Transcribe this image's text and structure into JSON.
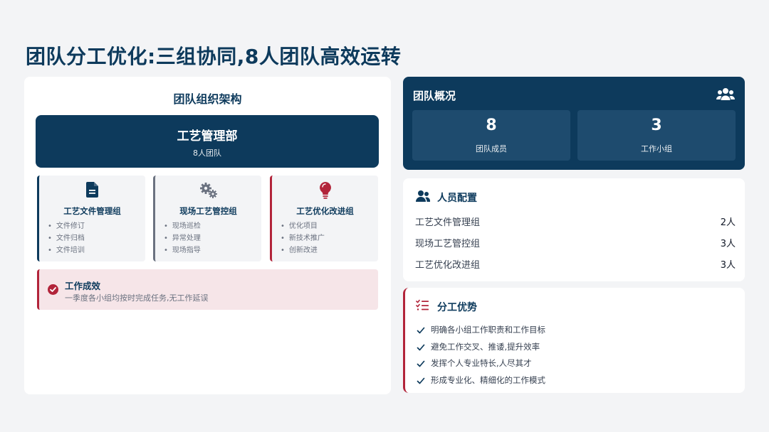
{
  "page": {
    "title": "团队分工优化:三组协同,8人团队高效运转"
  },
  "org": {
    "title": "团队组织架构",
    "department": {
      "name": "工艺管理部",
      "sub": "8人团队"
    },
    "groups": [
      {
        "name": "工艺文件管理组",
        "icon": "document-icon",
        "items": [
          "文件修订",
          "文件归档",
          "文件培训"
        ]
      },
      {
        "name": "现场工艺管控组",
        "icon": "gears-icon",
        "items": [
          "现场巡检",
          "异常处理",
          "现场指导"
        ]
      },
      {
        "name": "工艺优化改进组",
        "icon": "lightbulb-icon",
        "items": [
          "优化项目",
          "新技术推广",
          "创新改进"
        ]
      }
    ],
    "result": {
      "title": "工作成效",
      "desc": "一季度各小组均按时完成任务,无工作延误"
    }
  },
  "overview": {
    "title": "团队概况",
    "stats": [
      {
        "value": "8",
        "label": "团队成员"
      },
      {
        "value": "3",
        "label": "工作小组"
      }
    ]
  },
  "staff": {
    "title": "人员配置",
    "rows": [
      {
        "name": "工艺文件管理组",
        "count": "2人"
      },
      {
        "name": "现场工艺管控组",
        "count": "3人"
      },
      {
        "name": "工艺优化改进组",
        "count": "3人"
      }
    ]
  },
  "advantages": {
    "title": "分工优势",
    "items": [
      "明确各小组工作职责和工作目标",
      "避免工作交叉、推诿,提升效率",
      "发挥个人专业特长,人尽其才",
      "形成专业化、精细化的工作模式"
    ]
  },
  "colors": {
    "navy": "#0d3a5c",
    "accent_red": "#b2243a",
    "gray": "#6b7280"
  }
}
